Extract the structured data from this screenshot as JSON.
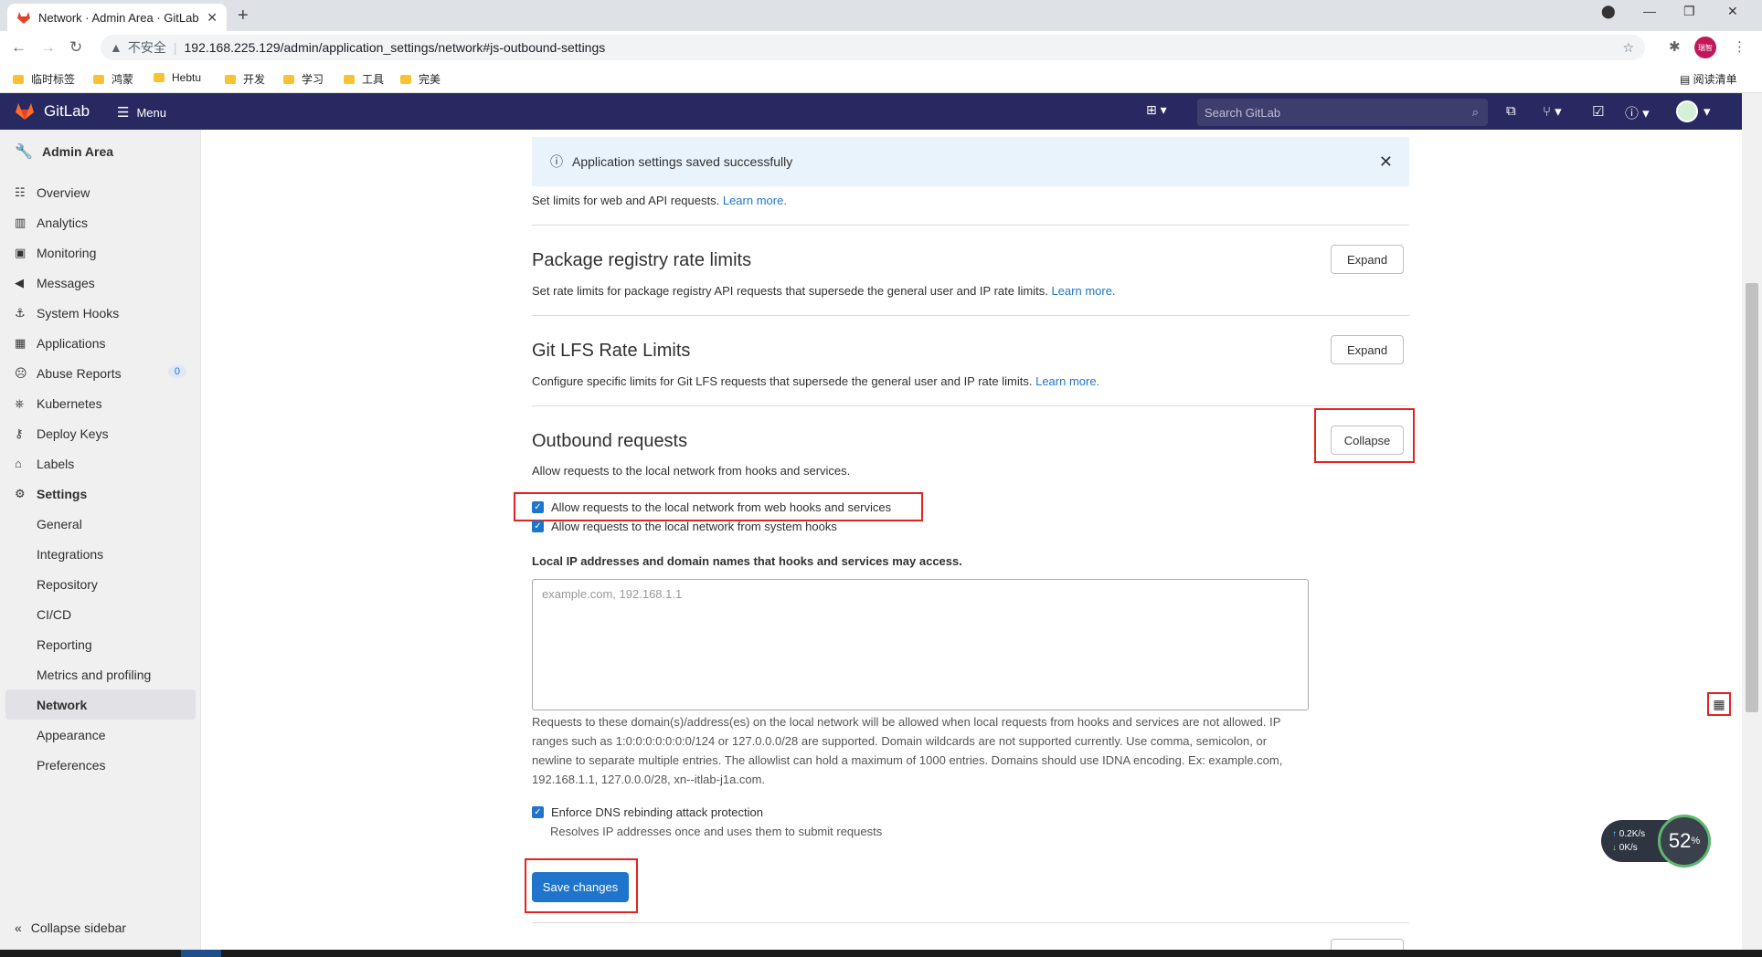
{
  "browser": {
    "tab_title": "Network · Admin Area · GitLab",
    "security_label": "不安全",
    "url": "192.168.225.129/admin/application_settings/network#js-outbound-settings",
    "profile_label": "瑞智",
    "bookmarks": [
      "临时标签",
      "鸿蒙",
      "Hebtu",
      "开发",
      "学习",
      "工具",
      "完美"
    ],
    "reading_list": "阅读清单"
  },
  "header": {
    "brand": "GitLab",
    "menu_label": "Menu",
    "search_placeholder": "Search GitLab"
  },
  "sidebar": {
    "title": "Admin Area",
    "items": [
      {
        "label": "Overview",
        "icon": "overview-icon"
      },
      {
        "label": "Analytics",
        "icon": "analytics-icon"
      },
      {
        "label": "Monitoring",
        "icon": "monitoring-icon"
      },
      {
        "label": "Messages",
        "icon": "messages-icon"
      },
      {
        "label": "System Hooks",
        "icon": "hook-icon"
      },
      {
        "label": "Applications",
        "icon": "applications-icon"
      },
      {
        "label": "Abuse Reports",
        "icon": "abuse-icon",
        "badge": "0"
      },
      {
        "label": "Kubernetes",
        "icon": "kubernetes-icon"
      },
      {
        "label": "Deploy Keys",
        "icon": "key-icon"
      },
      {
        "label": "Labels",
        "icon": "label-icon"
      },
      {
        "label": "Settings",
        "icon": "settings-icon"
      }
    ],
    "settings_sub": [
      "General",
      "Integrations",
      "Repository",
      "CI/CD",
      "Reporting",
      "Metrics and profiling",
      "Network",
      "Appearance",
      "Preferences"
    ],
    "active_item": "Network",
    "collapse_label": "Collapse sidebar"
  },
  "main": {
    "alert": "Application settings saved successfully",
    "top_text": "Set limits for web and API requests.",
    "learn_more": "Learn more.",
    "sections": [
      {
        "title": "Package registry rate limits",
        "desc": "Set rate limits for package registry API requests that supersede the general user and IP rate limits.",
        "button": "Expand"
      },
      {
        "title": "Git LFS Rate Limits",
        "desc": "Configure specific limits for Git LFS requests that supersede the general user and IP rate limits.",
        "button": "Expand"
      },
      {
        "title": "Outbound requests",
        "desc": "Allow requests to the local network from hooks and services.",
        "button": "Collapse"
      }
    ],
    "checkbox_webhooks": "Allow requests to the local network from web hooks and services",
    "checkbox_systemhooks": "Allow requests to the local network from system hooks",
    "allowlist_label": "Local IP addresses and domain names that hooks and services may access.",
    "allowlist_placeholder": "example.com, 192.168.1.1",
    "allowlist_help": "Requests to these domain(s)/address(es) on the local network will be allowed when local requests from hooks and services are not allowed. IP ranges such as 1:0:0:0:0:0:0:0/124 or 127.0.0.0/28 are supported. Domain wildcards are not supported currently. Use comma, semicolon, or newline to separate multiple entries. The allowlist can hold a maximum of 1000 entries. Domains should use IDNA encoding. Ex: example.com, 192.168.1.1, 127.0.0.0/28, xn--itlab-j1a.com.",
    "checkbox_dns": "Enforce DNS rebinding attack protection",
    "dns_help": "Resolves IP addresses once and uses them to submit requests",
    "save_label": "Save changes"
  },
  "widget": {
    "up_rate": "0.2",
    "down_rate": "0",
    "rate_unit": "K/s",
    "percent": "52",
    "percent_unit": "%"
  }
}
